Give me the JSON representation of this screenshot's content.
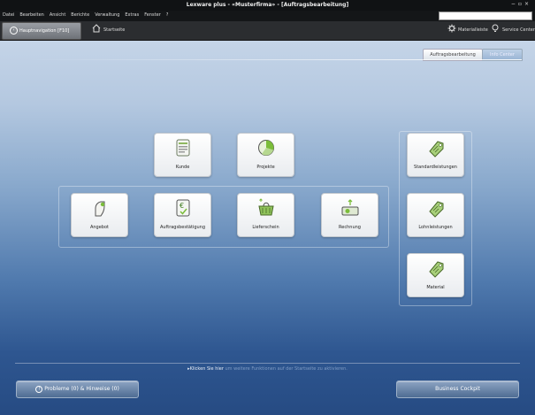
{
  "window": {
    "title": "Lexware plus - «Musterfirma» - [Auftragsbearbeitung]",
    "controls": [
      "−",
      "▫",
      "×"
    ]
  },
  "menu": [
    "Datei",
    "Bearbeiten",
    "Ansicht",
    "Berichte",
    "Verwaltung",
    "Extras",
    "Fenster",
    "?"
  ],
  "nav": {
    "main_label": "Hauptnavigation [F10]",
    "start_label": "Startseite",
    "materialleiste_label": "Materialleiste",
    "service_label": "Service Center"
  },
  "tabs": [
    "Auftragsbearbeitung",
    "Info Center"
  ],
  "tiles": [
    {
      "label": "Kunde",
      "icon": "customer-document-icon"
    },
    {
      "label": "Projekte",
      "icon": "projects-pie-icon"
    },
    {
      "label": "Angebot",
      "icon": "offer-hand-icon"
    },
    {
      "label": "Auftragsbestätigung",
      "icon": "order-confirmation-icon"
    },
    {
      "label": "Lieferschein",
      "icon": "delivery-basket-icon"
    },
    {
      "label": "Rechnung",
      "icon": "invoice-money-icon"
    },
    {
      "label": "Standardleistungen",
      "icon": "price-tag-icon"
    },
    {
      "label": "Lohnleistungen",
      "icon": "price-tag-icon"
    },
    {
      "label": "Material",
      "icon": "price-tag-icon"
    }
  ],
  "hint": {
    "prefix": "▸Klicken Sie hier",
    "suffix": "um weitere Funktionen auf der Startseite zu aktivieren."
  },
  "footer": {
    "problems_label": "Probleme (0) & Hinweise (0)",
    "cockpit_label": "Business Cockpit"
  },
  "colors": {
    "accent_green": "#7bbd3a",
    "bar_dark": "#2b2d30"
  }
}
